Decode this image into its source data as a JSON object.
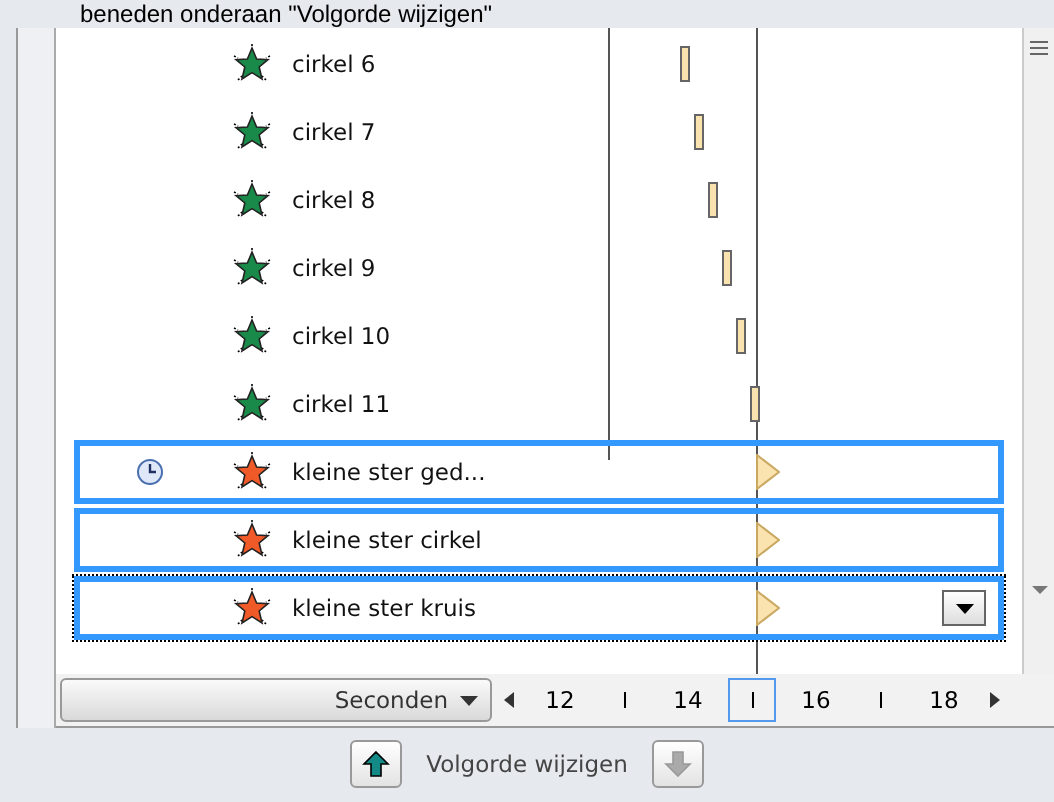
{
  "caption": "beneden onderaan \"Volgorde wijzigen\"",
  "effects": [
    {
      "name": "cirkel 6",
      "color": "#1a8a4a",
      "timed": false,
      "selected": false,
      "focused": false,
      "kind": "bar"
    },
    {
      "name": "cirkel 7",
      "color": "#1a8a4a",
      "timed": false,
      "selected": false,
      "focused": false,
      "kind": "bar"
    },
    {
      "name": "cirkel 8",
      "color": "#1a8a4a",
      "timed": false,
      "selected": false,
      "focused": false,
      "kind": "bar"
    },
    {
      "name": "cirkel 9",
      "color": "#1a8a4a",
      "timed": false,
      "selected": false,
      "focused": false,
      "kind": "bar"
    },
    {
      "name": "cirkel 10",
      "color": "#1a8a4a",
      "timed": false,
      "selected": false,
      "focused": false,
      "kind": "bar"
    },
    {
      "name": "cirkel 11",
      "color": "#1a8a4a",
      "timed": false,
      "selected": false,
      "focused": false,
      "kind": "bar"
    },
    {
      "name": "kleine ster ged...",
      "color": "#f05a28",
      "timed": true,
      "selected": true,
      "focused": false,
      "kind": "triangle"
    },
    {
      "name": "kleine ster cirkel",
      "color": "#f05a28",
      "timed": false,
      "selected": true,
      "focused": false,
      "kind": "triangle"
    },
    {
      "name": "kleine ster kruis",
      "color": "#f05a28",
      "timed": false,
      "selected": true,
      "focused": true,
      "kind": "triangle"
    }
  ],
  "timeline": {
    "unit": "Seconden",
    "ticks": [
      "12",
      "14",
      "16",
      "18"
    ]
  },
  "reorder": {
    "label": "Volgorde wijzigen"
  }
}
